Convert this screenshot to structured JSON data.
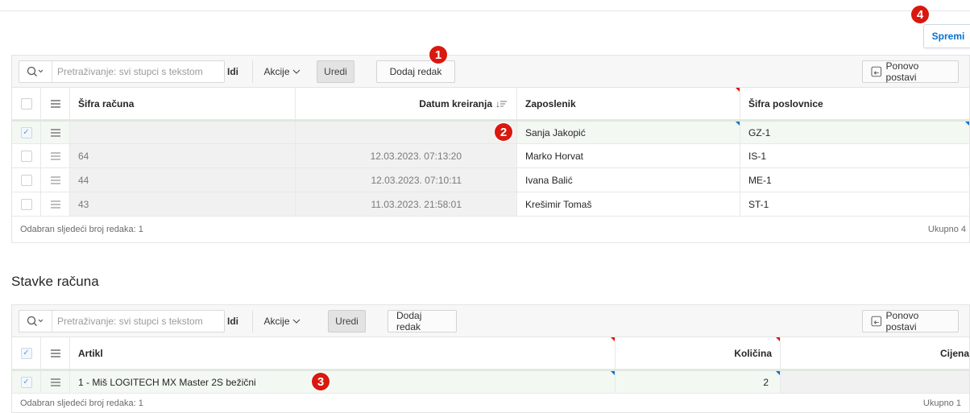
{
  "save_button": "Spremi",
  "badges": [
    "1",
    "2",
    "3",
    "4"
  ],
  "toolbar_common": {
    "search_placeholder": "Pretraživanje: svi stupci s tekstom",
    "go": "Idi",
    "actions": "Akcije",
    "edit": "Uredi",
    "add_row": "Dodaj redak",
    "reset": "Ponovo postavi"
  },
  "grid1": {
    "columns": [
      "Šifra računa",
      "Datum kreiranja",
      "Zaposlenik",
      "Šifra poslovnice"
    ],
    "sort_indicator": "↓",
    "rows": [
      {
        "sifra": "",
        "datum": "",
        "zaposlenik": "Sanja Jakopić",
        "poslovnica": "GZ-1"
      },
      {
        "sifra": "64",
        "datum": "12.03.2023. 07:13:20",
        "zaposlenik": "Marko Horvat",
        "poslovnica": "IS-1"
      },
      {
        "sifra": "44",
        "datum": "12.03.2023. 07:10:11",
        "zaposlenik": "Ivana Balić",
        "poslovnica": "ME-1"
      },
      {
        "sifra": "43",
        "datum": "11.03.2023. 21:58:01",
        "zaposlenik": "Krešimir Tomaš",
        "poslovnica": "ST-1"
      }
    ],
    "footer_left": "Odabran sljedeći broj redaka: 1",
    "footer_right": "Ukupno 4"
  },
  "section_title": "Stavke računa",
  "grid2": {
    "columns": [
      "Artikl",
      "Količina",
      "Cijena"
    ],
    "rows": [
      {
        "artikl": "1 - Miš LOGITECH MX Master 2S bežični",
        "kolicina": "2",
        "cijena": ""
      }
    ],
    "footer_left": "Odabran sljedeći broj redaka: 1",
    "footer_right": "Ukupno 1"
  }
}
